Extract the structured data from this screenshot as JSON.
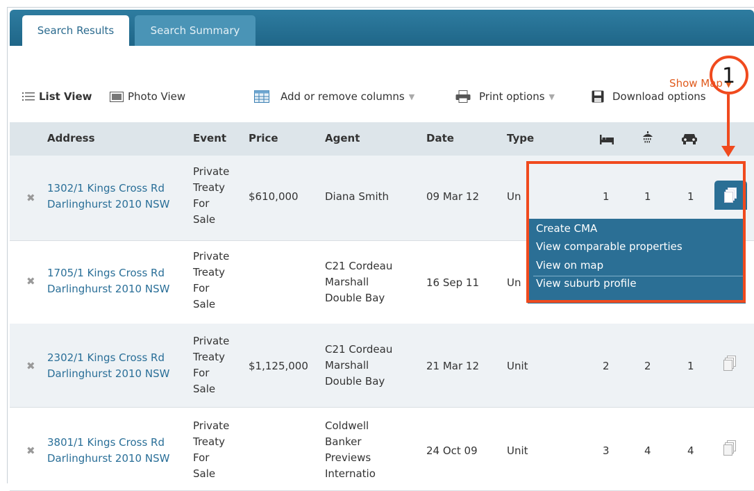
{
  "tabs": [
    {
      "label": "Search Results"
    },
    {
      "label": "Search Summary"
    }
  ],
  "show_map": "Show Map",
  "toolbar": {
    "list_view": "List View",
    "photo_view": "Photo View",
    "columns": "Add or remove columns",
    "print": "Print options",
    "download": "Download options"
  },
  "columns": {
    "address": "Address",
    "event": "Event",
    "price": "Price",
    "agent": "Agent",
    "date": "Date",
    "type": "Type",
    "bed_icon": "bed-icon",
    "bath_icon": "shower-icon",
    "car_icon": "car-icon"
  },
  "rows": [
    {
      "addr1": "1302/1 Kings Cross Rd",
      "addr2": "Darlinghurst 2010 NSW",
      "event": [
        "Private",
        "Treaty",
        "For",
        "Sale"
      ],
      "price": "$610,000",
      "agent": [
        "Diana Smith"
      ],
      "date": "09 Mar 12",
      "type": "Unit",
      "bed": "1",
      "bath": "1",
      "car": "1"
    },
    {
      "addr1": "1705/1 Kings Cross Rd",
      "addr2": "Darlinghurst 2010 NSW",
      "event": [
        "Private",
        "Treaty",
        "For",
        "Sale"
      ],
      "price": "",
      "agent": [
        "C21 Cordeau",
        "Marshall",
        "Double Bay"
      ],
      "date": "16 Sep 11",
      "type": "Un",
      "bed": "",
      "bath": "",
      "car": ""
    },
    {
      "addr1": "2302/1 Kings Cross Rd",
      "addr2": "Darlinghurst 2010 NSW",
      "event": [
        "Private",
        "Treaty",
        "For",
        "Sale"
      ],
      "price": "$1,125,000",
      "agent": [
        "C21 Cordeau",
        "Marshall",
        "Double Bay"
      ],
      "date": "21 Mar 12",
      "type": "Unit",
      "bed": "2",
      "bath": "2",
      "car": "1"
    },
    {
      "addr1": "3801/1 Kings Cross Rd",
      "addr2": "Darlinghurst 2010 NSW",
      "event": [
        "Private",
        "Treaty",
        "For",
        "Sale"
      ],
      "price": "",
      "agent": [
        "Coldwell",
        "Banker",
        "Previews",
        "Internatio"
      ],
      "date": "24 Oct 09",
      "type": "Unit",
      "bed": "3",
      "bath": "4",
      "car": "4"
    }
  ],
  "row1_type_visible": "Un",
  "popup_menu": [
    {
      "label": "Create CMA"
    },
    {
      "label": "View comparable properties"
    },
    {
      "label": "View on map"
    },
    {
      "label": "View suburb profile"
    }
  ],
  "annotation_number": "1",
  "colors": {
    "accent": "#f04a1e",
    "header_blue": "#2e7ca0",
    "link": "#2a6f98"
  }
}
